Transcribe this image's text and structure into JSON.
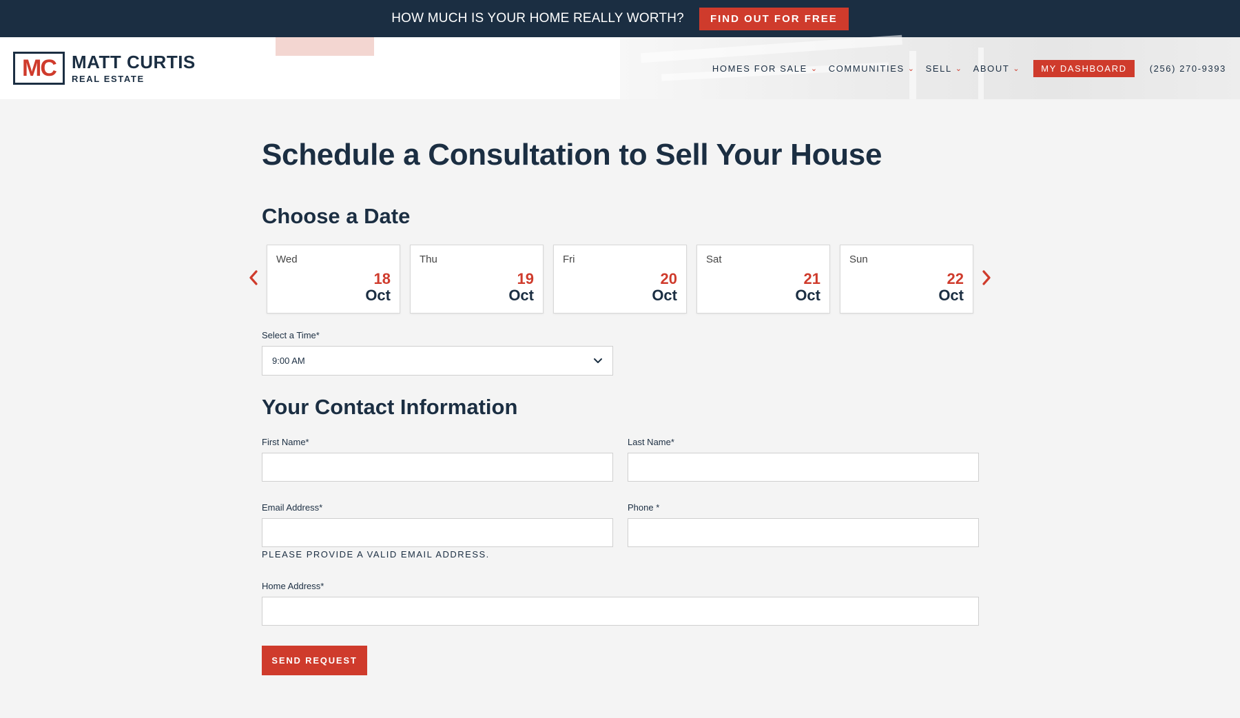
{
  "topbar": {
    "question": "HOW MUCH IS YOUR HOME REALLY WORTH?",
    "cta": "FIND OUT FOR FREE"
  },
  "brand": {
    "mark": "MC",
    "name": "MATT CURTIS",
    "sub": "REAL ESTATE"
  },
  "nav": {
    "items": [
      {
        "label": "HOMES FOR SALE",
        "icon": "chevron-down-icon"
      },
      {
        "label": "COMMUNITIES",
        "icon": "chevron-down-icon"
      },
      {
        "label": "SELL",
        "icon": "chevron-down-icon"
      },
      {
        "label": "ABOUT",
        "icon": "chevron-down-icon"
      }
    ],
    "dashboard": "MY DASHBOARD",
    "phone": "(256) 270-9393"
  },
  "main": {
    "title": "Schedule a Consultation to Sell Your House",
    "date_section": "Choose a Date",
    "dates": [
      {
        "day": "Wed",
        "num": "18",
        "month": "Oct"
      },
      {
        "day": "Thu",
        "num": "19",
        "month": "Oct"
      },
      {
        "day": "Fri",
        "num": "20",
        "month": "Oct"
      },
      {
        "day": "Sat",
        "num": "21",
        "month": "Oct"
      },
      {
        "day": "Sun",
        "num": "22",
        "month": "Oct"
      }
    ],
    "time_label": "Select a Time*",
    "time_value": "9:00 AM",
    "contact_section": "Your Contact Information",
    "first_name_label": "First Name*",
    "last_name_label": "Last Name*",
    "email_label": "Email Address*",
    "phone_label": "Phone *",
    "email_error": "PLEASE PROVIDE A VALID EMAIL ADDRESS.",
    "address_label": "Home Address*",
    "submit": "SEND REQUEST"
  },
  "colors": {
    "navy": "#1b2e42",
    "accent": "#cf3b2c",
    "background": "#f4f4f4"
  }
}
